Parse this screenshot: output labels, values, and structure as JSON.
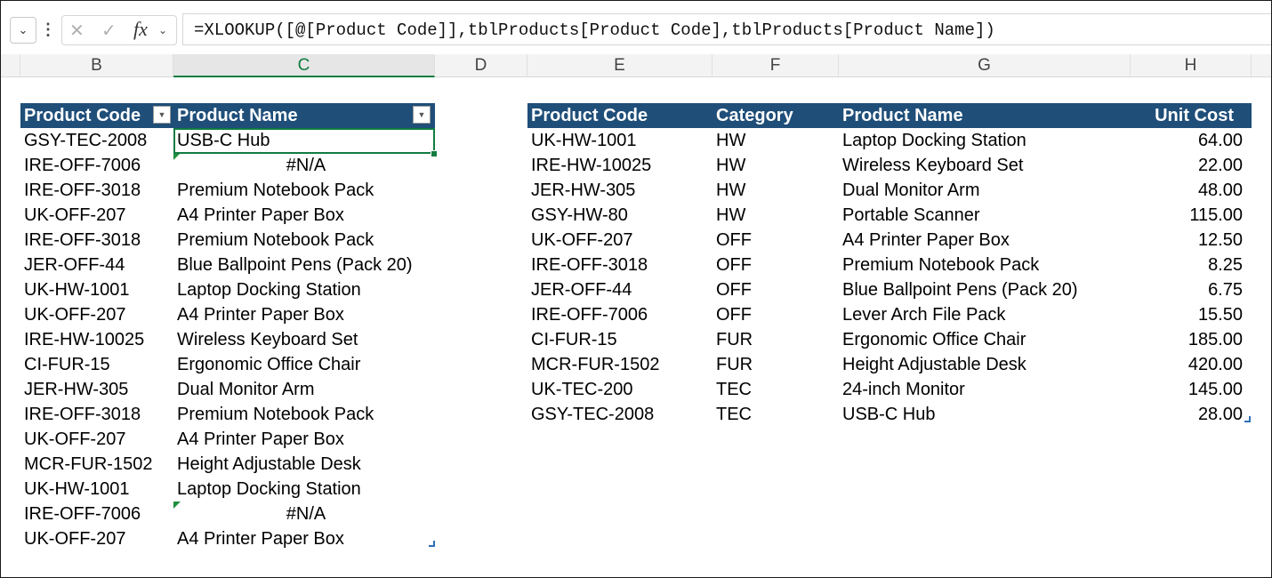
{
  "formula_bar": {
    "formula": "=XLOOKUP([@[Product Code]],tblProducts[Product Code],tblProducts[Product Name])"
  },
  "columns": [
    "B",
    "C",
    "D",
    "E",
    "F",
    "G",
    "H"
  ],
  "left_table": {
    "headers": [
      "Product Code",
      "Product Name"
    ],
    "rows": [
      [
        "GSY-TEC-2008",
        "USB-C Hub"
      ],
      [
        "IRE-OFF-7006",
        "#N/A"
      ],
      [
        "IRE-OFF-3018",
        "Premium Notebook Pack"
      ],
      [
        "UK-OFF-207",
        "A4 Printer Paper Box"
      ],
      [
        "IRE-OFF-3018",
        "Premium Notebook Pack"
      ],
      [
        "JER-OFF-44",
        "Blue Ballpoint Pens (Pack 20)"
      ],
      [
        "UK-HW-1001",
        "Laptop Docking Station"
      ],
      [
        "UK-OFF-207",
        "A4 Printer Paper Box"
      ],
      [
        "IRE-HW-10025",
        "Wireless Keyboard Set"
      ],
      [
        "CI-FUR-15",
        "Ergonomic Office Chair"
      ],
      [
        "JER-HW-305",
        "Dual Monitor Arm"
      ],
      [
        "IRE-OFF-3018",
        "Premium Notebook Pack"
      ],
      [
        "UK-OFF-207",
        "A4 Printer Paper Box"
      ],
      [
        "MCR-FUR-1502",
        "Height Adjustable Desk"
      ],
      [
        "UK-HW-1001",
        "Laptop Docking Station"
      ],
      [
        "IRE-OFF-7006",
        "#N/A"
      ],
      [
        "UK-OFF-207",
        "A4 Printer Paper Box"
      ]
    ]
  },
  "right_table": {
    "headers": [
      "Product Code",
      "Category",
      "Product Name",
      "Unit Cost"
    ],
    "rows": [
      [
        "UK-HW-1001",
        "HW",
        "Laptop Docking Station",
        "64.00"
      ],
      [
        "IRE-HW-10025",
        "HW",
        "Wireless Keyboard Set",
        "22.00"
      ],
      [
        "JER-HW-305",
        "HW",
        "Dual Monitor Arm",
        "48.00"
      ],
      [
        "GSY-HW-80",
        "HW",
        "Portable Scanner",
        "115.00"
      ],
      [
        "UK-OFF-207",
        "OFF",
        "A4 Printer Paper Box",
        "12.50"
      ],
      [
        "IRE-OFF-3018",
        "OFF",
        "Premium Notebook Pack",
        "8.25"
      ],
      [
        "JER-OFF-44",
        "OFF",
        "Blue Ballpoint Pens (Pack 20)",
        "6.75"
      ],
      [
        "IRE-OFF-7006",
        "OFF",
        "Lever Arch File Pack",
        "15.50"
      ],
      [
        "CI-FUR-15",
        "FUR",
        "Ergonomic Office Chair",
        "185.00"
      ],
      [
        "MCR-FUR-1502",
        "FUR",
        "Height Adjustable Desk",
        "420.00"
      ],
      [
        "UK-TEC-200",
        "TEC",
        "24-inch Monitor",
        "145.00"
      ],
      [
        "GSY-TEC-2008",
        "TEC",
        "USB-C Hub",
        "28.00"
      ]
    ]
  },
  "colors": {
    "header_bg": "#1f4e79",
    "selection": "#107c41"
  }
}
